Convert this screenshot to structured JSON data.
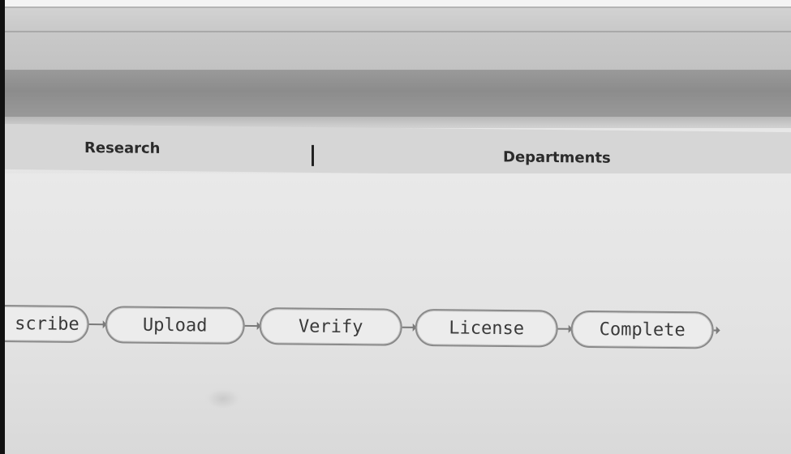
{
  "nav": {
    "items": [
      {
        "label": "Research"
      },
      {
        "label": "Departments"
      }
    ]
  },
  "workflow": {
    "steps": [
      {
        "label": "scribe"
      },
      {
        "label": "Upload"
      },
      {
        "label": "Verify"
      },
      {
        "label": "License"
      },
      {
        "label": "Complete"
      }
    ]
  }
}
